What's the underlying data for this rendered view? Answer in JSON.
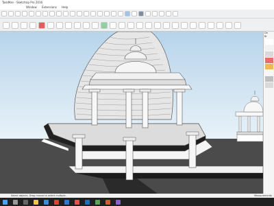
{
  "window": {
    "title": "TaskMan - SketchUp Pro 2016"
  },
  "menu": {
    "items": [
      "Window",
      "Extensions",
      "Help"
    ]
  },
  "right_panel": {
    "labels": [
      "De",
      "Br"
    ],
    "swatches": [
      "#ffffff",
      "#f2f2f2",
      "#d9d9d9",
      "#ef6b6b",
      "#f0b84e",
      "#f7f7f7",
      "#bfbfbf",
      "#dadada"
    ]
  },
  "status": {
    "text": "Select objects. Drag mouse to select multiple.",
    "measurements_label": "Measurements"
  },
  "taskbar": {
    "clock": ""
  }
}
